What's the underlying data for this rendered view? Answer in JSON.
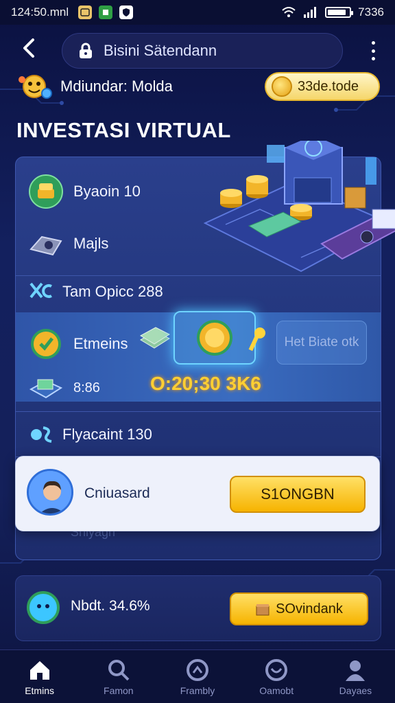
{
  "status_bar": {
    "time": "124:50.mnl",
    "right_text": "7336",
    "battery_level": 0.85,
    "icons": [
      "image-icon",
      "app-icon",
      "shield-icon",
      "wifi-icon",
      "signal-icon",
      "battery-icon"
    ]
  },
  "top_bar": {
    "url": "Bisini Sätendann",
    "back_icon": "chevron-left-icon",
    "menu_icon": "more-vertical-icon"
  },
  "user": {
    "name": "Mdiundar: Molda",
    "coin_balance": "33de.tode"
  },
  "page_title": "INVESTASI VIRTUAL",
  "card": {
    "rows": [
      {
        "label": "Byaoin 10",
        "icon": "gold-coin-stack-icon"
      },
      {
        "label": "Majls",
        "icon": "wallet-icon"
      },
      {
        "label": "Tam Opicc 288",
        "icon": "analytics-icon"
      },
      {
        "label": "Etmeins",
        "icon": "gear-check-icon"
      },
      {
        "label": "8:86",
        "icon": "cash-icon"
      },
      {
        "label": "Flyacaint 130",
        "icon": "finance-icon"
      }
    ],
    "rate_label": "Het Biate otk",
    "big_value": "O:20;30 3K6",
    "hidden_label": "Snlyagn"
  },
  "popup": {
    "name": "Cniuasard",
    "button_label": "S1ONGBN"
  },
  "bottom_card": {
    "text": "Nbdt. 34.6%",
    "button_label": "SOvindank"
  },
  "nav": [
    {
      "label": "Etmins",
      "icon": "home-icon",
      "active": true
    },
    {
      "label": "Famon",
      "icon": "investment-icon",
      "active": false
    },
    {
      "label": "Frambly",
      "icon": "analytics-icon",
      "active": false
    },
    {
      "label": "Oamobt",
      "icon": "wallet-icon",
      "active": false
    },
    {
      "label": "Dayaes",
      "icon": "profile-icon",
      "active": false
    }
  ],
  "colors": {
    "background": "#13205e",
    "accent_gold": "#f6b300",
    "highlight_blue": "#6fd4ff"
  }
}
